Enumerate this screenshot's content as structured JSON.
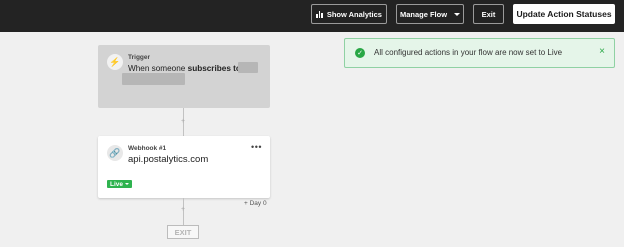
{
  "toolbar": {
    "show_analytics": "Show Analytics",
    "manage_flow": "Manage Flow",
    "exit": "Exit",
    "update_statuses": "Update Action Statuses"
  },
  "trigger": {
    "label": "Trigger",
    "text_prefix": "When someone",
    "text_bold": "subscribes to"
  },
  "webhook": {
    "label": "Webhook #1",
    "url": "api.postalytics.com",
    "status": "Live",
    "menu": "•••"
  },
  "flow": {
    "day_label": "+ Day 0",
    "exit_label": "EXIT"
  },
  "toast": {
    "message": "All configured actions in your flow are now set to Live",
    "close": "×"
  },
  "colors": {
    "topbar": "#232323",
    "live_green": "#2fb34f",
    "toast_bg": "#e5f5e9",
    "toast_border": "#8fd1a3"
  }
}
